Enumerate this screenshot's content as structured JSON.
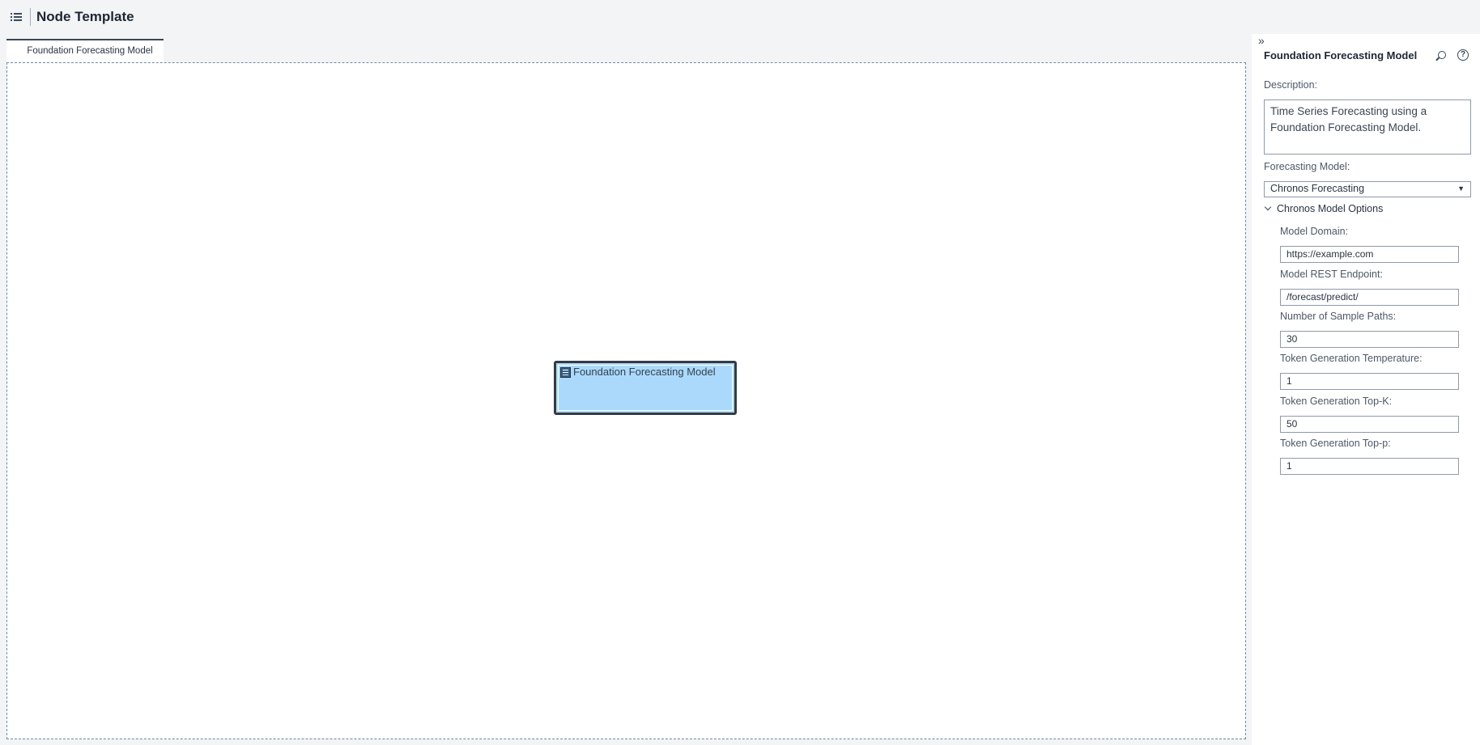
{
  "header": {
    "title": "Node Template",
    "menu_icon": "list-icon"
  },
  "tabs": [
    {
      "label": "Foundation Forecasting Model",
      "active": true
    }
  ],
  "canvas": {
    "node": {
      "label": "Foundation Forecasting Model",
      "icon": "forecast-model-icon",
      "selected": true
    }
  },
  "panel": {
    "collapse_icon": "»",
    "title": "Foundation Forecasting Model",
    "help_glyph": "?",
    "description": {
      "label": "Description:",
      "value": "Time Series Forecasting using a Foundation Forecasting Model."
    },
    "forecasting_model": {
      "label": "Forecasting Model:",
      "selected": "Chronos Forecasting",
      "arrow": "▼"
    },
    "options_group": {
      "label": "Chronos Model Options",
      "expanded": true,
      "fields": [
        {
          "label": "Model Domain:",
          "value": "https://example.com"
        },
        {
          "label": "Model REST Endpoint:",
          "value": "/forecast/predict/"
        },
        {
          "label": "Number of Sample Paths:",
          "value": "30"
        },
        {
          "label": "Token Generation Temperature:",
          "value": "1"
        },
        {
          "label": "Token Generation Top-K:",
          "value": "50"
        },
        {
          "label": "Token Generation Top-p:",
          "value": "1"
        }
      ]
    }
  },
  "colors": {
    "node_fill": "#abd9fb",
    "node_border": "#333b44",
    "canvas_border": "#6f8aa8",
    "background": "#f3f4f6"
  }
}
